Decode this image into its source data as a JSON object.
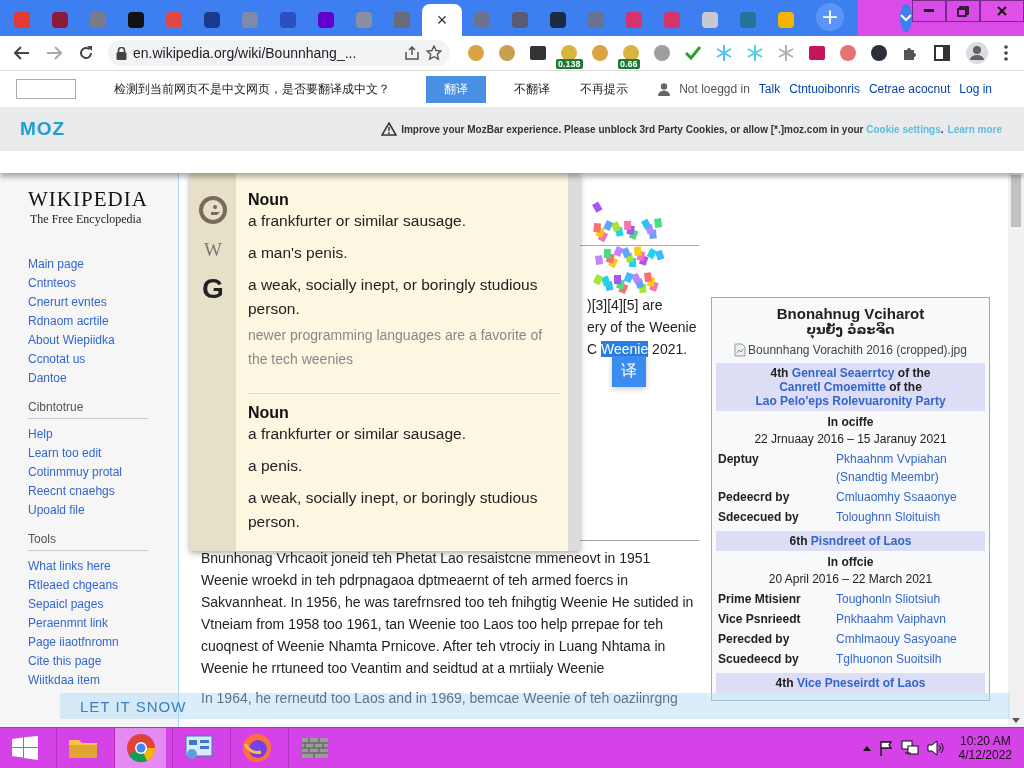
{
  "tabs": [
    {
      "selected": false,
      "color": "#e53935"
    },
    {
      "selected": false,
      "color": "#8e1b3a"
    },
    {
      "selected": false,
      "color": "#7a7a8c"
    },
    {
      "selected": false,
      "color": "#111111"
    },
    {
      "selected": false,
      "color": "#e04848"
    },
    {
      "selected": false,
      "color": "#1a3a8a"
    },
    {
      "selected": false,
      "color": "#7d8aa8"
    },
    {
      "selected": false,
      "color": "#2a4fc0"
    },
    {
      "selected": false,
      "color": "#6001d2"
    },
    {
      "selected": false,
      "color": "#8a8fa0"
    },
    {
      "selected": false,
      "color": "#6a6a7a"
    },
    {
      "selected": true
    },
    {
      "selected": false,
      "color": "#6a7390"
    },
    {
      "selected": false,
      "color": "#5a5a70"
    },
    {
      "selected": false,
      "color": "#1d2a44"
    },
    {
      "selected": false,
      "color": "#6a7390"
    },
    {
      "selected": false,
      "color": "#d6336c"
    },
    {
      "selected": false,
      "color": "#d6336c"
    },
    {
      "selected": false,
      "color": "#c8c8d0"
    },
    {
      "selected": false,
      "color": "#21759b"
    },
    {
      "selected": false,
      "color": "#f4b400"
    }
  ],
  "tab_close": "×",
  "new_tab": "+",
  "address": {
    "url": "en.wikipedia.org/wiki/Bounnhang_..."
  },
  "extensions": [
    {
      "kind": "circle",
      "color": "#d9a441"
    },
    {
      "kind": "circle",
      "color": "#c9a050"
    },
    {
      "kind": "square",
      "color": "#333333"
    },
    {
      "kind": "circle",
      "color": "#d9b441",
      "badge": "0.138"
    },
    {
      "kind": "circle",
      "color": "#d9a441"
    },
    {
      "kind": "circle",
      "color": "#d9b441",
      "badge": "0.66"
    },
    {
      "kind": "circle",
      "color": "#9e9e9e"
    },
    {
      "kind": "check",
      "color": "#2ca02c"
    },
    {
      "kind": "snow",
      "color": "#4fc3f7"
    },
    {
      "kind": "snow",
      "color": "#4dd0e1"
    },
    {
      "kind": "snow",
      "color": "#b0b0b8"
    },
    {
      "kind": "square",
      "color": "#c2185b"
    },
    {
      "kind": "circle",
      "color": "#e57373"
    },
    {
      "kind": "circle",
      "color": "#2b2f3a"
    }
  ],
  "translate_bar": {
    "message": "检测到当前网页不是中文网页，是否要翻译成中文？",
    "buttons": [
      {
        "label": "翻译",
        "primary": true
      },
      {
        "label": "不翻译",
        "primary": false
      },
      {
        "label": "不再提示",
        "primary": false
      }
    ]
  },
  "personal": {
    "status": "Not loeggd in",
    "links": [
      "Talk",
      "Ctntuoibonris",
      "Cetrae acocnut",
      "Log in"
    ]
  },
  "mozbar": {
    "logo": "MOZ",
    "message": "Improve your MozBar experience. Please unblock 3rd Party Cookies, or allow [*.]moz.com in your ",
    "link": "Cookie settings",
    "after": ".",
    "learn_more": "Learn more"
  },
  "sidebar": {
    "logo": "WIKIPEDIA",
    "tagline": "The Free Encyclopedia",
    "nav": [
      "Main page",
      "Cntnteos",
      "Cnerurt evntes",
      "Rdnaom acrtile",
      "About Wiepiidka",
      "Ccnotat us",
      "Dantoe"
    ],
    "sections": [
      {
        "title": "Cibntotrue",
        "items": [
          "Help",
          "Learn too edit",
          "Cotinmmuy protal",
          "Reecnt cnaehgs",
          "Upoald file"
        ]
      },
      {
        "title": "Tools",
        "items": [
          "What links here",
          "Rtleaed chgeans",
          "Sepaicl pages",
          "Peraenmnt link",
          "Page iiaotfnromn",
          "Cite this page",
          "Wiitkdaa item"
        ]
      }
    ]
  },
  "article": {
    "fragments": [
      {
        "text": ")[3][4][5] are"
      },
      {
        "text": "ery of the Weenie"
      },
      {
        "before": "C ",
        "highlight": "Weenie",
        "text": " 2021."
      }
    ],
    "translate_bubble": "译",
    "paragraphs": [
      "Bnunhonag Vrhcaoit joneid teh Phetat Lao resaistcne mmeneovt in 1951 Weenie wroekd in teh pdrpnagaoa dptmeaernt of teh armed foercs in Sakvannheat. In 1956, he was tarefrnsred too teh fnihgtig Weenie He sutided in Vtneiam from 1958 too 1961, tan Weenie too Laos too help prrepae for teh cuoqnest of Weenie Nhamta Prnicove. After teh vtrociy in Luang Nhtama in Weenie he rrtuneed too Veantim and seidtud at a mrtiialy Weenie",
      "In 1964, he rerneutd too Laos and in 1969, bemcae Weenie of teh oaziinrgng"
    ]
  },
  "dictionary": {
    "entries": [
      {
        "pos": "Noun",
        "senses": [
          {
            "text": "a frankfurter or similar sausage."
          },
          {
            "text": "a man's penis."
          },
          {
            "text": "a weak, socially inept, or boringly studious person.",
            "example": "newer programming languages are a favorite of the tech weenies"
          }
        ]
      },
      {
        "pos": "Noun",
        "senses": [
          {
            "text": "a frankfurter or similar sausage."
          },
          {
            "text": "a penis."
          },
          {
            "text": "a weak, socially inept, or boringly studious person."
          }
        ]
      }
    ],
    "sources": [
      "W",
      "G"
    ]
  },
  "infobox": {
    "title": "Bnonahnug Vciharot",
    "native_name": "ບຸນຍັງ ວໍລະຈິດ",
    "image_alt": "Bounnhang Vorachith 2016 (cropped).jpg",
    "offices": [
      {
        "header": [
          {
            "kind": "plain",
            "text": "4th "
          },
          {
            "kind": "link",
            "text": "Genreal Seaerrtcy"
          },
          {
            "kind": "plain",
            "text": " of the "
          },
          {
            "kind": "link",
            "text": "Canretl Cmoemitte"
          },
          {
            "kind": "plain",
            "text": " of the "
          },
          {
            "kind": "link",
            "text": "Lao Pelo'eps Rolevuaronity Party"
          }
        ],
        "term_label": "In ociffe",
        "term": "22 Jrnuaay 2016 – 15 Jaranuy 2021",
        "rows": [
          {
            "label": "Deptuy",
            "values": [
              "Pkhaahnm Vvpiahan",
              "(Snandtig Meembr)"
            ]
          },
          {
            "label": "Pedeecrd by",
            "values": [
              "Cmluaomhy Ssaaonye"
            ]
          },
          {
            "label": "Sdececued by",
            "values": [
              "Toloughnn Sloituish"
            ]
          }
        ]
      },
      {
        "header": [
          {
            "kind": "plain",
            "text": "6th "
          },
          {
            "kind": "link",
            "text": "Pisndreet of Laos"
          }
        ],
        "term_label": "In offcie",
        "term": "20 April 2016 – 22 March 2021",
        "rows": [
          {
            "label": "Prime Mtisienr",
            "values": [
              "Toughonln Sliotsiuh"
            ]
          },
          {
            "label": "Vice Psnrieedt",
            "values": [
              "Pnkhaahm Vaiphavn"
            ]
          },
          {
            "label": "Perecded by",
            "values": [
              "Cmhlmaouy Sasyoane"
            ]
          },
          {
            "label": "Scuedeecd by",
            "values": [
              "Tglhuonon Suoitsilh"
            ]
          }
        ]
      },
      {
        "header": [
          {
            "kind": "plain",
            "text": "4th "
          },
          {
            "kind": "link",
            "text": "Vice Pneseirdt of Laos"
          }
        ]
      }
    ]
  },
  "snow_banner": "LET IT SNOW",
  "taskbar": {
    "apps": [
      {
        "kind": "explorer",
        "selected": false
      },
      {
        "kind": "chrome",
        "selected": true
      },
      {
        "kind": "control-panel",
        "selected": false
      },
      {
        "kind": "firefox",
        "selected": false
      },
      {
        "kind": "wall",
        "selected": false
      }
    ],
    "time": "10:20 AM",
    "date": "4/12/2022"
  }
}
